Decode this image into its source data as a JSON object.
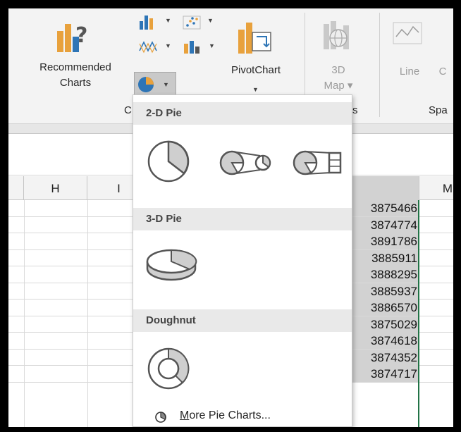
{
  "ribbon": {
    "recommended_charts": "Recommended Charts",
    "recommended_line1": "Recommended",
    "recommended_line2": "Charts",
    "pivotchart": "PivotChart",
    "map3d_line1": "3D",
    "map3d_line2": "Map",
    "line": "Line",
    "column_partial": "C",
    "group_charts_partial": "C",
    "group_tours_partial": "s",
    "group_sparklines_partial": "Spa"
  },
  "columns": {
    "h": "H",
    "i": "I",
    "m": "M"
  },
  "cells": [
    "3875466",
    "3874774",
    "3891786",
    "3885911",
    "3888295",
    "3885937",
    "3886570",
    "3875029",
    "3874618",
    "3874352",
    "3874717"
  ],
  "dropdown": {
    "section_2d": "2-D Pie",
    "section_3d": "3-D Pie",
    "section_doughnut": "Doughnut",
    "more_prefix": "M",
    "more_rest": "ore Pie Charts...",
    "options_2d": [
      "pie-icon",
      "pie-of-pie-icon",
      "bar-of-pie-icon"
    ],
    "options_3d": [
      "3d-pie-icon"
    ],
    "options_doughnut": [
      "doughnut-icon"
    ]
  },
  "colors": {
    "accent": "#217346",
    "selected_fill": "#d2d2d2",
    "icon_orange": "#e8a13c",
    "icon_blue": "#2e75b6"
  }
}
